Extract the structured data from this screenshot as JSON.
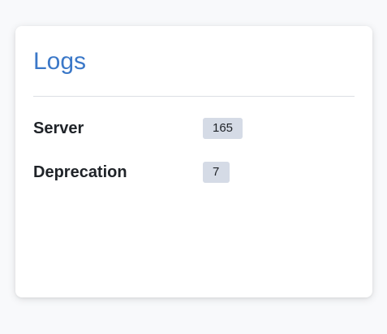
{
  "card": {
    "title": "Logs",
    "rows": [
      {
        "label": "Server",
        "count": "165"
      },
      {
        "label": "Deprecation",
        "count": "7"
      }
    ]
  },
  "colors": {
    "title": "#3b78c8",
    "badge_bg": "#d5dbe6",
    "page_bg": "#f8f9fb"
  }
}
